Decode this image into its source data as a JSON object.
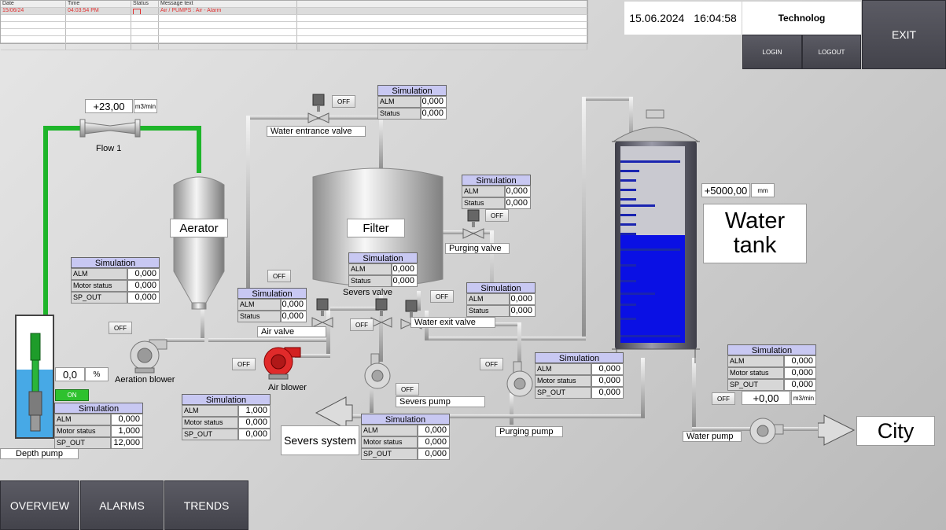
{
  "alarm_table": {
    "headers": [
      "Date",
      "Time",
      "Status",
      "Message text"
    ],
    "rows": [
      {
        "date": "15/06/24",
        "time": "04:03:54 PM",
        "status": "",
        "message": "Air / PUMPS : Air - Alarm"
      }
    ]
  },
  "header": {
    "date": "15.06.2024",
    "time": "16:04:58",
    "user": "Technolog",
    "login_label": "LOGIN",
    "logout_label": "LOGOUT",
    "exit_label": "EXIT"
  },
  "nav": {
    "overview": "OVERVIEW",
    "alarms": "ALARMS",
    "trends": "TRENDS"
  },
  "labels": {
    "flow1": "Flow 1",
    "aerator": "Aerator",
    "filter": "Filter",
    "water_entrance_valve": "Water entrance valve",
    "purging_valve": "Purging valve",
    "severs_valve": "Severs valve",
    "water_exit_valve": "Water exit valve",
    "air_valve": "Air valve",
    "aeration_blower": "Aeration blower",
    "air_blower": "Air blower",
    "severs_pump": "Severs pump",
    "purging_pump": "Purging pump",
    "water_pump": "Water pump",
    "depth_pump": "Depth pump",
    "severs_system": "Severs system",
    "water_tank": "Water tank",
    "city": "City"
  },
  "values": {
    "flow1": "+23,00",
    "flow1_unit": "m3/min",
    "tank_level": "+5000,00",
    "tank_unit": "mm",
    "depth_pct": "0,0",
    "depth_unit": "%",
    "water_flow": "+0,00",
    "water_flow_unit": "m3/min",
    "tank_fill_fraction": 0.55
  },
  "buttons": {
    "off": "OFF",
    "on": "ON"
  },
  "sim": {
    "title": "Simulation",
    "water_entrance_valve": [
      {
        "k": "ALM",
        "v": "0,000"
      },
      {
        "k": "Status",
        "v": "0,000"
      }
    ],
    "purging_valve": [
      {
        "k": "ALM",
        "v": "0,000"
      },
      {
        "k": "Status",
        "v": "0,000"
      }
    ],
    "severs_valve": [
      {
        "k": "ALM",
        "v": "0,000"
      },
      {
        "k": "Status",
        "v": "0,000"
      }
    ],
    "water_exit_valve": [
      {
        "k": "ALM",
        "v": "0,000"
      },
      {
        "k": "Status",
        "v": "0,000"
      }
    ],
    "air_valve": [
      {
        "k": "ALM",
        "v": "0,000"
      },
      {
        "k": "Status",
        "v": "0,000"
      }
    ],
    "aeration_blower": [
      {
        "k": "ALM",
        "v": "0,000"
      },
      {
        "k": "Motor status",
        "v": "0,000"
      },
      {
        "k": "SP_OUT",
        "v": "0,000"
      }
    ],
    "air_blower": [
      {
        "k": "ALM",
        "v": "1,000"
      },
      {
        "k": "Motor status",
        "v": "0,000"
      },
      {
        "k": "SP_OUT",
        "v": "0,000"
      }
    ],
    "depth_pump": [
      {
        "k": "ALM",
        "v": "0,000"
      },
      {
        "k": "Motor status",
        "v": "1,000"
      },
      {
        "k": "SP_OUT",
        "v": "12,000"
      }
    ],
    "severs_pump": [
      {
        "k": "ALM",
        "v": "0,000"
      },
      {
        "k": "Motor status",
        "v": "0,000"
      },
      {
        "k": "SP_OUT",
        "v": "0,000"
      }
    ],
    "purging_pump": [
      {
        "k": "ALM",
        "v": "0,000"
      },
      {
        "k": "Motor status",
        "v": "0,000"
      },
      {
        "k": "SP_OUT",
        "v": "0,000"
      }
    ],
    "water_pump": [
      {
        "k": "ALM",
        "v": "0,000"
      },
      {
        "k": "Motor status",
        "v": "0,000"
      },
      {
        "k": "SP_OUT",
        "v": "0,000"
      }
    ]
  }
}
